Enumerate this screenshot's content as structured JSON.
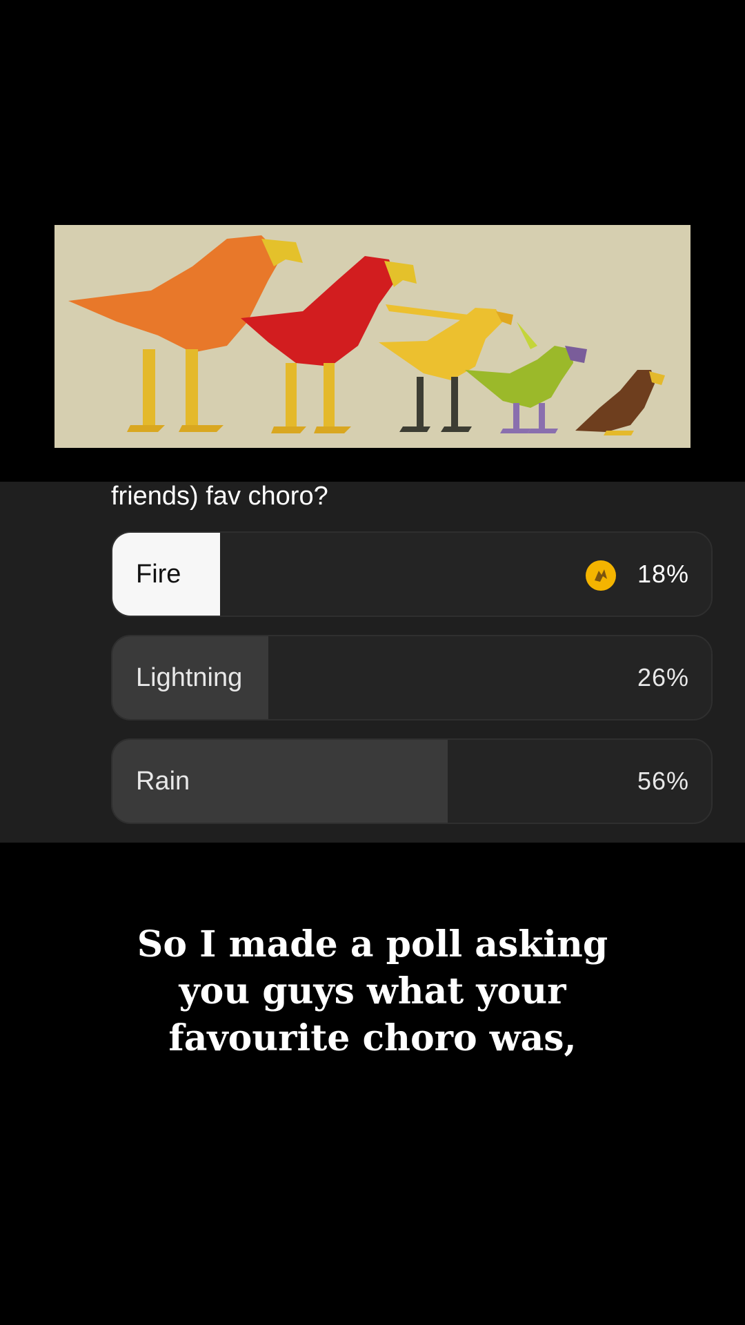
{
  "poll": {
    "question": "friends) fav choro?",
    "options": [
      {
        "label": "Fire",
        "percent": "18%",
        "share": 0.18,
        "selected": true
      },
      {
        "label": "Lightning",
        "percent": "26%",
        "share": 0.26,
        "selected": false
      },
      {
        "label": "Rain",
        "percent": "56%",
        "share": 0.56,
        "selected": false
      }
    ],
    "selected_badge_icon": "voter-avatar-icon"
  },
  "caption": {
    "lines": [
      "So I made a poll asking",
      "you guys what your",
      "favourite choro was,"
    ]
  },
  "banner": {
    "image": "chocobo-lineup-illustration"
  },
  "colors": {
    "background": "#000000",
    "panel": "#1f1f1f",
    "option_track": "#242424",
    "selected_fill": "#f7f7f7",
    "unselected_fill": "#3a3a3a",
    "badge": "#f4b400"
  }
}
